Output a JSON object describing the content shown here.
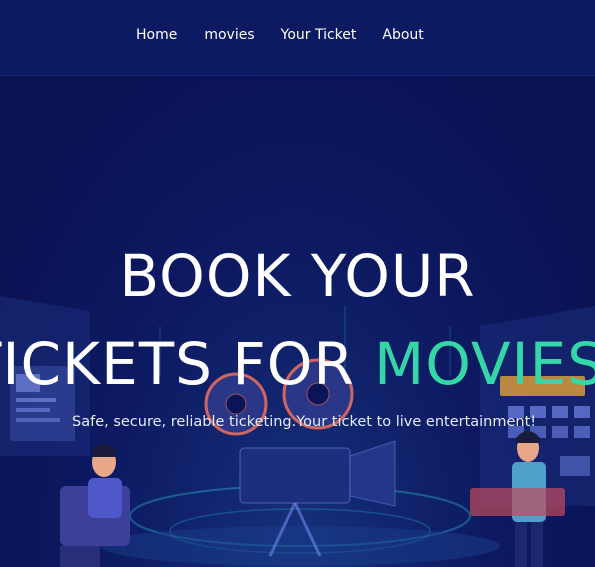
{
  "nav": {
    "items": [
      {
        "label": "Home"
      },
      {
        "label": "movies"
      },
      {
        "label": "Your Ticket"
      },
      {
        "label": "About"
      }
    ]
  },
  "hero": {
    "line1": "BOOK YOUR",
    "line2_prefix": "TICKETS FOR ",
    "line2_accent": "MOVIES",
    "tagline": "Safe, secure, reliable ticketing.Your ticket to live entertainment!"
  },
  "colors": {
    "background": "#0b1456",
    "navbar": "#0c1a62",
    "accent": "#35d7a8",
    "text": "#ffffff"
  }
}
